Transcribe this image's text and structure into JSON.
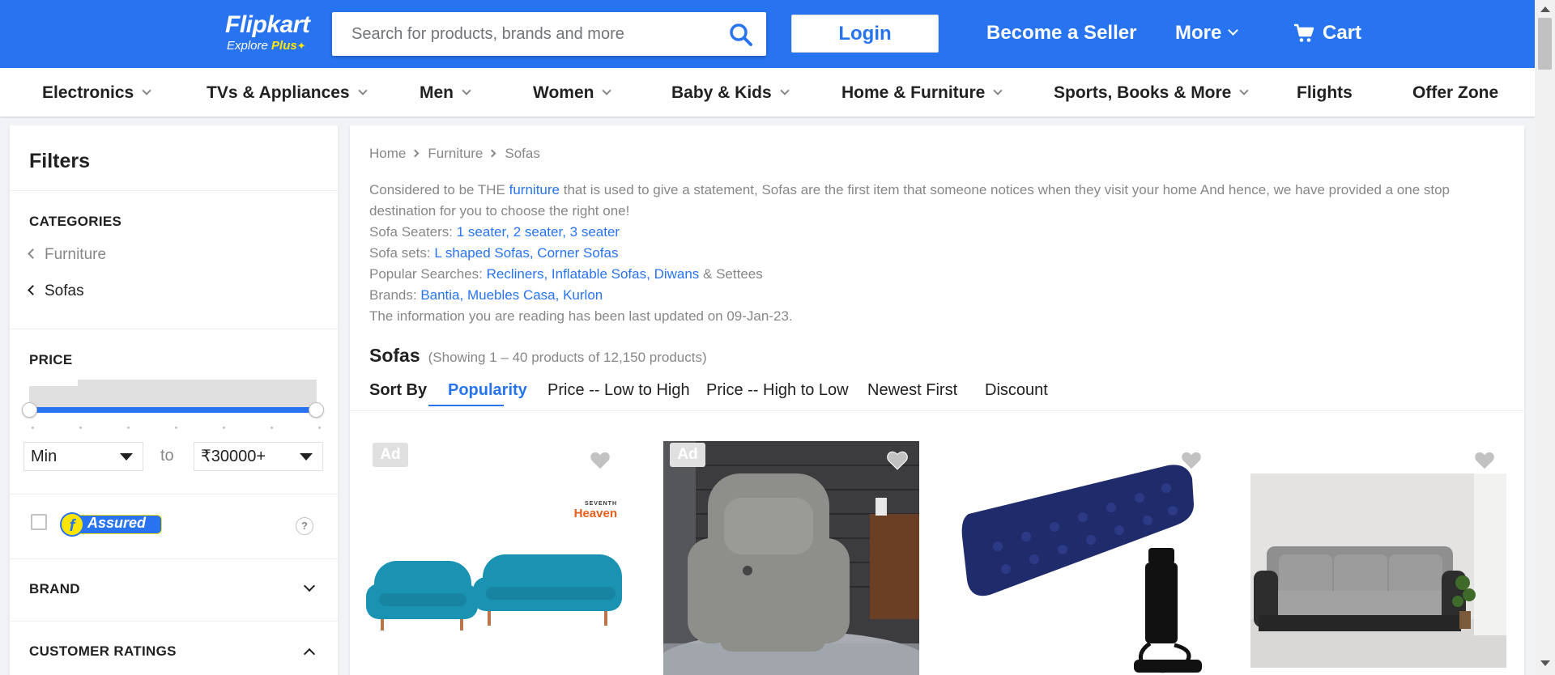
{
  "header": {
    "logo_name": "Flipkart",
    "logo_explore": "Explore",
    "logo_plus": "Plus",
    "search_placeholder": "Search for products, brands and more",
    "login_label": "Login",
    "seller_label": "Become a Seller",
    "more_label": "More",
    "cart_label": "Cart",
    "brand_color": "#2874f0"
  },
  "categories": [
    {
      "label": "Electronics",
      "has_dropdown": true
    },
    {
      "label": "TVs & Appliances",
      "has_dropdown": true
    },
    {
      "label": "Men",
      "has_dropdown": true
    },
    {
      "label": "Women",
      "has_dropdown": true
    },
    {
      "label": "Baby & Kids",
      "has_dropdown": true
    },
    {
      "label": "Home & Furniture",
      "has_dropdown": true
    },
    {
      "label": "Sports, Books & More",
      "has_dropdown": true
    },
    {
      "label": "Flights",
      "has_dropdown": false
    },
    {
      "label": "Offer Zone",
      "has_dropdown": false
    }
  ],
  "filters": {
    "title": "Filters",
    "categories_heading": "CATEGORIES",
    "category_items": [
      "Furniture",
      "Sofas"
    ],
    "price_heading": "PRICE",
    "price_min": "Min",
    "price_to": "to",
    "price_max": "₹30000+",
    "assured_label": "Assured",
    "help_label": "?",
    "brand_heading": "BRAND",
    "ratings_heading": "CUSTOMER RATINGS"
  },
  "breadcrumb": [
    "Home",
    "Furniture",
    "Sofas"
  ],
  "description": {
    "line1_a": "Considered to be THE ",
    "line1_link": "furniture",
    "line1_b": " that is used to give a statement, Sofas are the first item that someone notices when they visit your home And hence, we have provided a one stop destination for you to choose the right one!",
    "seaters_label": "Sofa Seaters: ",
    "seaters_links": [
      "1 seater",
      "2 seater",
      "3 seater"
    ],
    "sets_label": "Sofa sets: ",
    "sets_links": [
      "L shaped Sofas",
      "Corner Sofas"
    ],
    "popular_label": "Popular Searches: ",
    "popular_links": [
      "Recliners",
      "Inflatable Sofas",
      "Diwans"
    ],
    "popular_tail": " & Settees",
    "brands_label": "Brands: ",
    "brands_links": [
      "Bantia",
      "Muebles Casa",
      "Kurlon"
    ],
    "updated": "The information you are reading has been last updated on 09-Jan-23."
  },
  "products_heading": {
    "title": "Sofas",
    "count": "(Showing 1 – 40 products of 12,150 products)"
  },
  "sort": {
    "label": "Sort By",
    "options": [
      "Popularity",
      "Price -- Low to High",
      "Price -- High to Low",
      "Newest First",
      "Discount"
    ],
    "active": "Popularity"
  },
  "products": [
    {
      "ad": "Ad",
      "is_ad": true,
      "brand_tag": "Heaven",
      "brand_tag_top": "SEVENTH",
      "image": "teal-sofa-set"
    },
    {
      "ad": "Ad",
      "is_ad": true,
      "image": "grey-recliner"
    },
    {
      "is_ad": false,
      "image": "inflatable-bed-with-pump"
    },
    {
      "is_ad": false,
      "image": "grey-3-seater-sofa"
    }
  ]
}
